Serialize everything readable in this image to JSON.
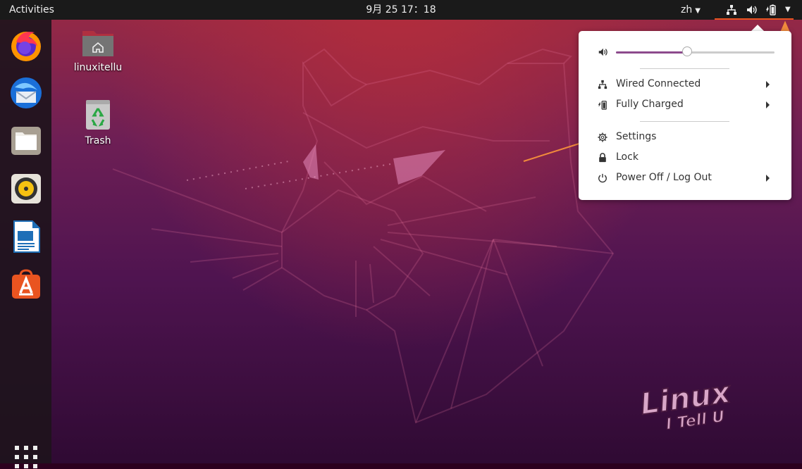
{
  "topbar": {
    "activities": "Activities",
    "clock": "9月 25  17：18",
    "language": "zh"
  },
  "desktop": {
    "icons": [
      {
        "label": "linuxitellu",
        "icon": "home-folder-icon"
      },
      {
        "label": "Trash",
        "icon": "trash-icon"
      }
    ]
  },
  "dock": {
    "apps": [
      "firefox-icon",
      "thunderbird-icon",
      "files-icon",
      "rhythmbox-icon",
      "libreoffice-writer-icon",
      "software-center-icon"
    ]
  },
  "system_menu": {
    "volume_level": 0.45,
    "items": [
      {
        "label": "Wired Connected",
        "icon": "network-wired-icon",
        "submenu": true
      },
      {
        "label": "Fully Charged",
        "icon": "battery-icon",
        "submenu": true
      },
      {
        "label": "Settings",
        "icon": "settings-gear-icon",
        "submenu": false
      },
      {
        "label": "Lock",
        "icon": "lock-icon",
        "submenu": false
      },
      {
        "label": "Power Off / Log Out",
        "icon": "power-icon",
        "submenu": true
      }
    ]
  },
  "watermark": {
    "line1": "Linux",
    "line2": "I Tell U"
  },
  "colors": {
    "accent": "#e95420",
    "topbar": "#1a1a1a",
    "slider": "#8c4a8c",
    "annotation_arrow": "#f08a3c"
  }
}
